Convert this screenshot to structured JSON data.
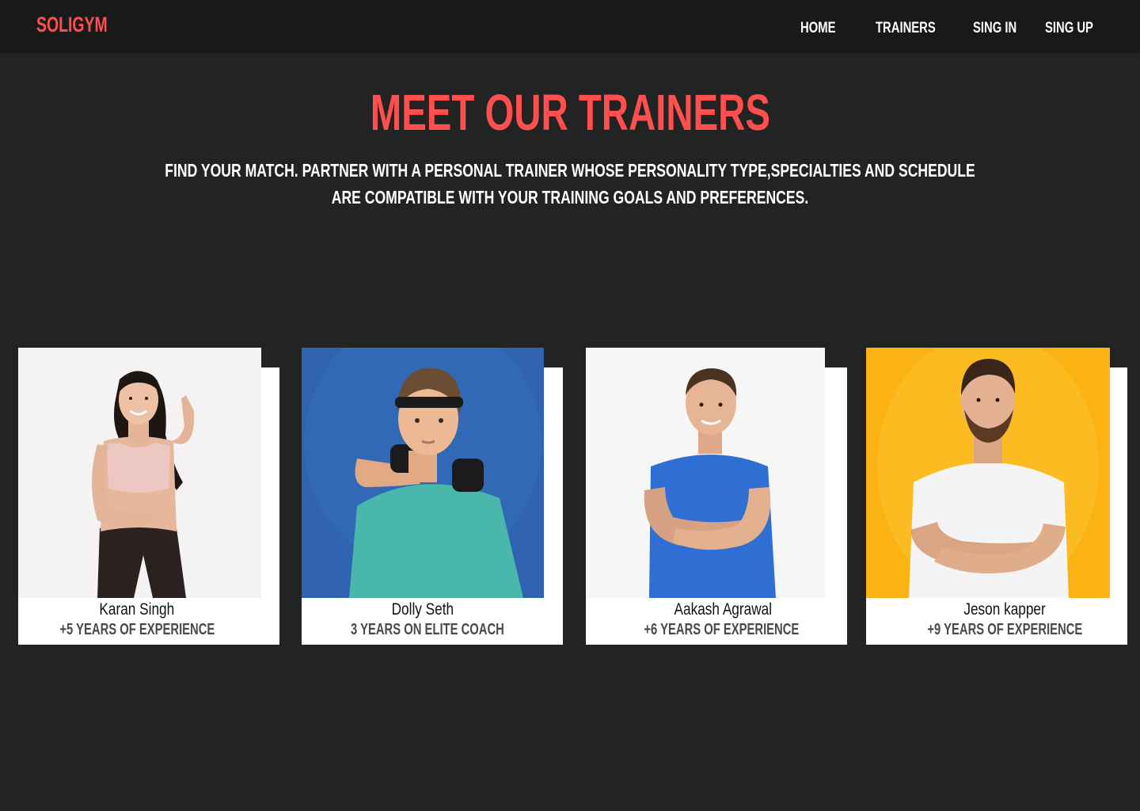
{
  "brand": {
    "logo": "SOLIGYM",
    "accent": "#ff4f4f"
  },
  "nav": {
    "home": "HOME",
    "trainers": "TRAINERS",
    "sign_in": "SING IN",
    "sign_up": "SING UP"
  },
  "hero": {
    "title": "MEET OUR TRAINERS",
    "subtitle": "FIND YOUR MATCH. PARTNER WITH A PERSONAL TRAINER WHOSE PERSONALITY TYPE,SPECIALTIES AND SCHEDULE ARE COMPATIBLE WITH YOUR TRAINING GOALS AND PREFERENCES."
  },
  "trainers": [
    {
      "name": "Karan Singh",
      "experience": "+5 YEARS OF EXPERIENCE",
      "photo_bg": "#f4f2f2"
    },
    {
      "name": "Dolly Seth",
      "experience": "3 YEARS ON ELITE COACH",
      "photo_bg": "#2f63b0"
    },
    {
      "name": "Aakash Agrawal",
      "experience": "+6 YEARS OF EXPERIENCE",
      "photo_bg": "#f6f6f6"
    },
    {
      "name": "Jeson kapper",
      "experience": "+9 YEARS OF EXPERIENCE",
      "photo_bg": "#fbb313"
    }
  ]
}
